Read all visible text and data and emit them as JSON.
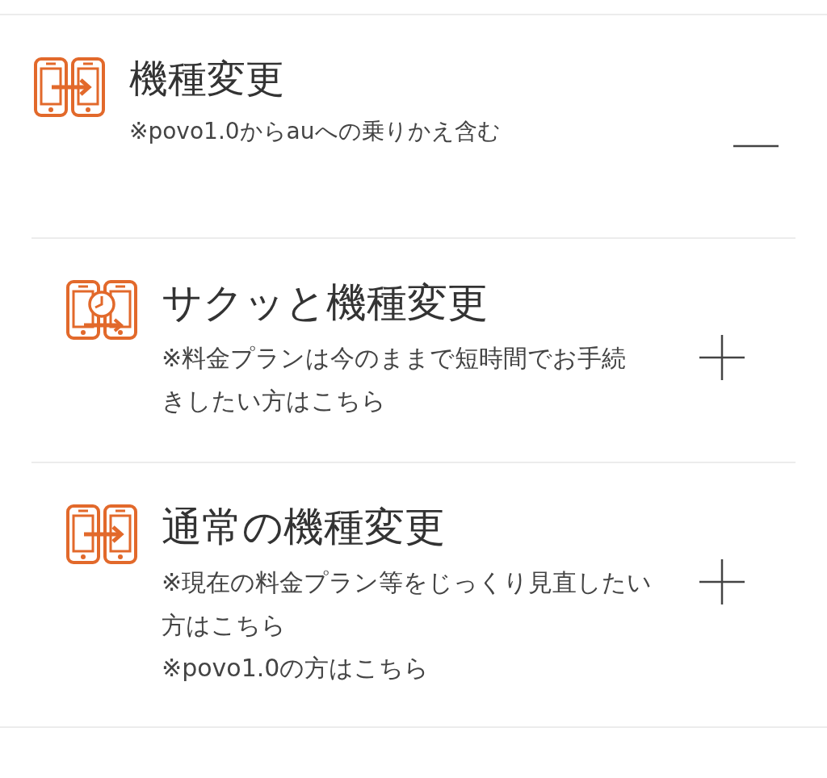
{
  "header": {
    "kind": "phones",
    "title": "機種変更",
    "notes": [
      [
        "※povo1.0からauへの乗りかえ含む"
      ]
    ],
    "expanded": true
  },
  "items": [
    {
      "kind": "clock",
      "title": "サクッと機種変更",
      "notes": [
        [
          "※料金プランは今のままで短時間でお手続",
          "きしたい方はこちら"
        ]
      ],
      "expanded": false
    },
    {
      "kind": "phones",
      "title": "通常の機種変更",
      "notes": [
        [
          "※現在の料金プラン等をじっくり見直したい",
          "方はこちら"
        ],
        [
          "※povo1.0の方はこちら"
        ]
      ],
      "expanded": false
    }
  ]
}
